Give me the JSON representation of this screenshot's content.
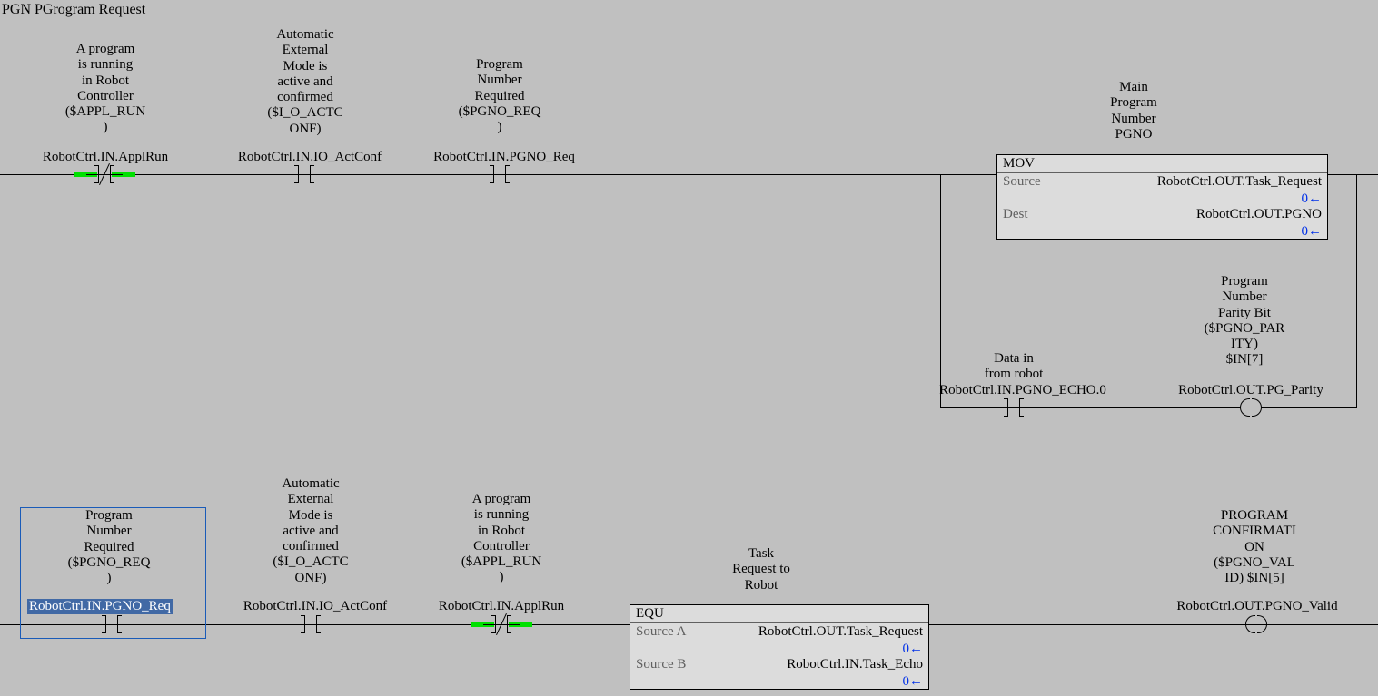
{
  "title": "PGN PGrogram Request",
  "rung1": {
    "c1": {
      "desc": "A program\nis running\nin Robot\nController\n($APPL_RUN\n)",
      "tag": "RobotCtrl.IN.ApplRun"
    },
    "c2": {
      "desc": "Automatic\nExternal\nMode is\nactive and\nconfirmed\n($I_O_ACTC\nONF)",
      "tag": "RobotCtrl.IN.IO_ActConf"
    },
    "c3": {
      "desc": "Program\nNumber\nRequired\n($PGNO_REQ\n)",
      "tag": "RobotCtrl.IN.PGNO_Req"
    },
    "mov": {
      "desc": "Main\nProgram\nNumber\nPGNO",
      "name": "MOV",
      "sourceK": "Source",
      "sourceV": "RobotCtrl.OUT.Task_Request",
      "sourceVal": "0",
      "destK": "Dest",
      "destV": "RobotCtrl.OUT.PGNO",
      "destVal": "0"
    },
    "branch": {
      "echo": {
        "desc": "Data in\nfrom robot",
        "tag": "RobotCtrl.IN.PGNO_ECHO.0"
      },
      "parity": {
        "desc": "Program\nNumber\nParity Bit\n($PGNO_PAR\nITY)\n$IN[7]",
        "tag": "RobotCtrl.OUT.PG_Parity"
      }
    }
  },
  "rung2": {
    "c1": {
      "desc": "Program\nNumber\nRequired\n($PGNO_REQ\n)",
      "tag": "RobotCtrl.IN.PGNO_Req"
    },
    "c2": {
      "desc": "Automatic\nExternal\nMode is\nactive and\nconfirmed\n($I_O_ACTC\nONF)",
      "tag": "RobotCtrl.IN.IO_ActConf"
    },
    "c3": {
      "desc": "A program\nis running\nin Robot\nController\n($APPL_RUN\n)",
      "tag": "RobotCtrl.IN.ApplRun"
    },
    "equ": {
      "desc": "Task\nRequest to\nRobot",
      "name": "EQU",
      "aK": "Source A",
      "aV": "RobotCtrl.OUT.Task_Request",
      "aVal": "0",
      "bK": "Source B",
      "bV": "RobotCtrl.IN.Task_Echo",
      "bVal": "0"
    },
    "coil": {
      "desc": "PROGRAM\nCONFIRMATI\nON\n($PGNO_VAL\nID) $IN[5]",
      "tag": "RobotCtrl.OUT.PGNO_Valid"
    }
  }
}
